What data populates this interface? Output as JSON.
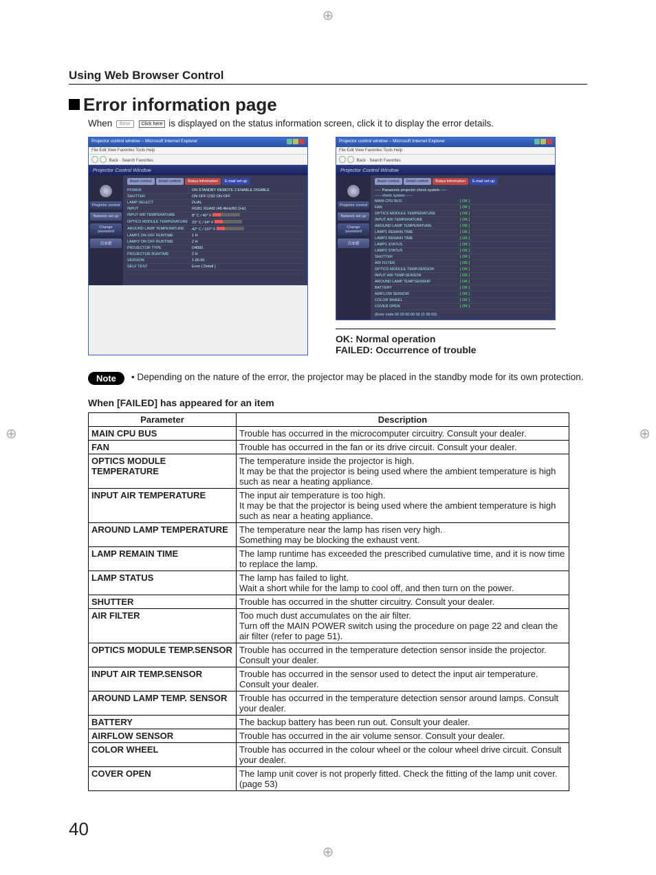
{
  "header": {
    "breadcrumb": "Using Web Browser Control"
  },
  "title": "Error information page",
  "intro": {
    "prefix": "When",
    "chip_error": "Error",
    "chip_click": "Click here",
    "suffix": "is displayed on the status information screen, click it to display the error details."
  },
  "screenshot": {
    "window_title": "Projector control window – Microsoft Internet Explorer",
    "menu": "File   Edit   View   Favorites   Tools   Help",
    "toolbar": "Back   ·   Search   Favorites",
    "pcw_bar": "Projector Control Window",
    "sidebar": [
      "Projector control",
      "Network set up",
      "Change password",
      "日本語"
    ],
    "tabs": [
      "Basic control",
      "Detail control",
      "Status information",
      "E-mail set up"
    ],
    "status_lines": [
      {
        "k": "POWER",
        "v": "ON   STANDBY   REMOTE 2         ENABLE   DISABLE"
      },
      {
        "k": "SHUTTER",
        "v": "ON   OFF   OSD                     ON   OFF"
      },
      {
        "k": "LAMP SELECT",
        "v": "DUAL"
      },
      {
        "k": "INPUT",
        "v": "RGB1   XGA60 (48.4kHz/60.1Hz)"
      },
      {
        "k": "INPUT AIR TEMPERATURE",
        "v": "8° C / 40° F"
      },
      {
        "k": "OPTICS MODULE TEMPERATURE",
        "v": "23° C / 64° F"
      },
      {
        "k": "AROUND LAMP TEMPERATURE",
        "v": "42° C / 107° F"
      },
      {
        "k": "LAMP1   ON  OFF   RUNTIME",
        "v": "1 H"
      },
      {
        "k": "LAMP2   ON  OFF   RUNTIME",
        "v": "2 H"
      },
      {
        "k": "PROJECTOR TYPE",
        "v": "D4000"
      },
      {
        "k": "PROJECTOR RUNTIME",
        "v": "2 H"
      },
      {
        "k": "VERSION",
        "v": "1.00.00"
      },
      {
        "k": "SELF TEST",
        "v": "Error ( Detail )"
      }
    ],
    "check_header1": "----- Panasonic projector check system -----",
    "check_header2": "----- check system -----",
    "check_items": [
      "MAIN CPU BUS",
      "FAN",
      "OPTICS MODULE TEMPERATURE",
      "INPUT AIR TEMPERATURE",
      "AROUND LAMP TEMPERATURE",
      "LAMP1 REMAIN TIME",
      "LAMP2 REMAIN TIME",
      "LAMP1 STATUS",
      "LAMP2 STATUS",
      "SHUTTER",
      "AIR FILTER",
      "OPTICS MODULE TEMP.SENSOR",
      "INPUT AIR TEMP.SENSOR",
      "AROUND LAMP TEMP.SENSOR",
      "BATTERY",
      "AIRFLOW SENSOR",
      "COLOR WHEEL",
      "COVER OPEN"
    ],
    "ok_label": "[ OK ]",
    "error_code": "(Error code 00 00 00 00 00 11 00 00)"
  },
  "captions": {
    "ok": "OK: Normal operation",
    "failed": "FAILED: Occurrence of trouble"
  },
  "note": {
    "label": "Note",
    "bullet": "• Depending on the nature of the error, the projector may be placed in the standby mode for its own protection."
  },
  "table_title": "When [FAILED] has appeared for an item",
  "table_headers": {
    "param": "Parameter",
    "desc": "Description"
  },
  "rows": [
    {
      "p": "MAIN CPU BUS",
      "d": "Trouble has occurred in the microcomputer circuitry. Consult your dealer."
    },
    {
      "p": "FAN",
      "d": "Trouble has occurred in the fan or its drive circuit. Consult your dealer."
    },
    {
      "p": "OPTICS MODULE TEMPERATURE",
      "d": "The temperature inside the projector is high.\nIt may be that the projector is being used where the ambient temperature is high such as near a heating appliance."
    },
    {
      "p": "INPUT AIR TEMPERATURE",
      "d": "The input air temperature is too high.\nIt may be that the projector is being used where the ambient temperature is high such as near a heating appliance."
    },
    {
      "p": "AROUND LAMP TEMPERATURE",
      "d": "The temperature near the lamp has risen very high.\nSomething may be blocking the exhaust vent."
    },
    {
      "p": "LAMP REMAIN TIME",
      "d": "The lamp runtime has exceeded the prescribed cumulative time, and it is now time to replace the lamp."
    },
    {
      "p": "LAMP STATUS",
      "d": "The lamp has failed to light.\nWait a short while for the lamp to cool off, and then turn on the power."
    },
    {
      "p": "SHUTTER",
      "d": "Trouble has occurred in the shutter circuitry. Consult your dealer."
    },
    {
      "p": "AIR FILTER",
      "d": "Too much dust accumulates on the air filter.\nTurn off the MAIN POWER switch using the procedure on page 22 and clean the air filter (refer to page 51)."
    },
    {
      "p": "OPTICS MODULE TEMP.SENSOR",
      "d": "Trouble has occurred in the temperature detection sensor inside the projector. Consult your dealer."
    },
    {
      "p": "INPUT AIR TEMP.SENSOR",
      "d": "Trouble has occurred in the sensor used to detect the input air temperature. Consult your dealer."
    },
    {
      "p": "AROUND LAMP TEMP. SENSOR",
      "d": "Trouble has occurred in the temperature detection sensor around lamps. Consult your dealer."
    },
    {
      "p": "BATTERY",
      "d": "The backup battery has been run out. Consult your dealer."
    },
    {
      "p": "AIRFLOW SENSOR",
      "d": "Trouble has occurred in the air volume sensor. Consult your dealer."
    },
    {
      "p": "COLOR WHEEL",
      "d": "Trouble has occurred in the colour wheel or the colour wheel drive circuit. Consult your dealer."
    },
    {
      "p": "COVER OPEN",
      "d": "The lamp unit cover is not properly fitted. Check the fitting of the lamp unit cover. (page 53)"
    }
  ],
  "page_number": "40"
}
